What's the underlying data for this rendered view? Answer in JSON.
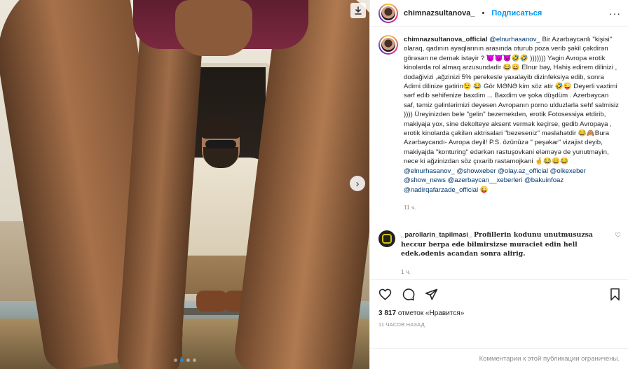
{
  "header": {
    "username": "chimnazsultanova_",
    "separator": "•",
    "follow_label": "Подписаться",
    "more_label": "···"
  },
  "caption": {
    "username": "chimnazsultanova_official",
    "parts": [
      {
        "t": "@elnurhasanov_",
        "m": true
      },
      {
        "t": " Bir Azərbaycanlı \"kişisi\" olaraq, qadının ayaqlarının arasında oturub poza verib şəkil çəkdirən görəsən ne demək istəyir ? 👿👿👿🤣🤣 ))))))) Yagin Avropa erotik kinolarda rol almaq arzusundadir 😂😄 Elnur bəy, Hahiş edirem dilinizi , dodağivizi ,ağzinizi 5% perekesle yaxalayib dizinfeksiya edib, sonra Adimi dilinize gətirin😉 😂 Gör MƏNƏ kim söz atir 🤣😜 Deyerli vaxtimi sərf edib sehifenize baxdim ... Baxdim ve şoka düşdüm . Azerbaycan saf, təmiz gəlinlərimizi deyesen Avropanın porno ulduzlarla sehf salmisiz )))) Üreyinizden bele \"gelin\" bezemekden, erotik Fotosessiya etdirib, makiyaja yox, sine dekolteye aksent vermək keçirse, gedib Avropaya , erotik kinolarda çəkilən aktrisalari \"bezeseniz\" məslahətdir 😂🙈Bura Azərbaycandı- Avropa deyil! P.S. özünüzə \" peşəkar\" vizajist deyib, makiyajda \"konturing\" edərkən rastuşovkani eləməyə de yunutmayin, nece ki ağzinizdan söz çıxarib rastamojkani 🤞😂😄😂 ",
        "m": false
      },
      {
        "t": "@elnurhasanov_",
        "m": true
      },
      {
        "t": " ",
        "m": false
      },
      {
        "t": "@showxeber",
        "m": true
      },
      {
        "t": " ",
        "m": false
      },
      {
        "t": "@olay.az_official",
        "m": true
      },
      {
        "t": " ",
        "m": false
      },
      {
        "t": "@olkexeber",
        "m": true
      },
      {
        "t": " ",
        "m": false
      },
      {
        "t": "@show_news",
        "m": true
      },
      {
        "t": " ",
        "m": false
      },
      {
        "t": "@azerbaycan__xeberleri",
        "m": true
      },
      {
        "t": " ",
        "m": false
      },
      {
        "t": "@bakuinfoaz",
        "m": true
      },
      {
        "t": " ",
        "m": false
      },
      {
        "t": "@nadirqafarzade_official",
        "m": true
      },
      {
        "t": " 😜",
        "m": false
      }
    ],
    "age": "11 ч."
  },
  "comment": {
    "username": "_parollarin_tapilmasi_",
    "text": "Profillerin kodunu unutmusuzsa heccur berpa ede bilmirsizse muraciet edin hell edek.odenis acandan sonra alirig.",
    "age": "1 ч.",
    "like_icon": "heart-outline-icon"
  },
  "actions": {
    "likes_count": "3 817",
    "likes_suffix": "отметок «Нравится»",
    "timestamp": "11 ЧАСОВ НАЗАД"
  },
  "footer": {
    "note": "Комментарии к этой публикации ограничены."
  },
  "carousel": {
    "dot_count": 4,
    "active_index": 1
  },
  "colors": {
    "accent": "#0095f6",
    "mention": "#00376b",
    "muted": "#8e8e8e",
    "dot_active": "#1a8fe3"
  }
}
